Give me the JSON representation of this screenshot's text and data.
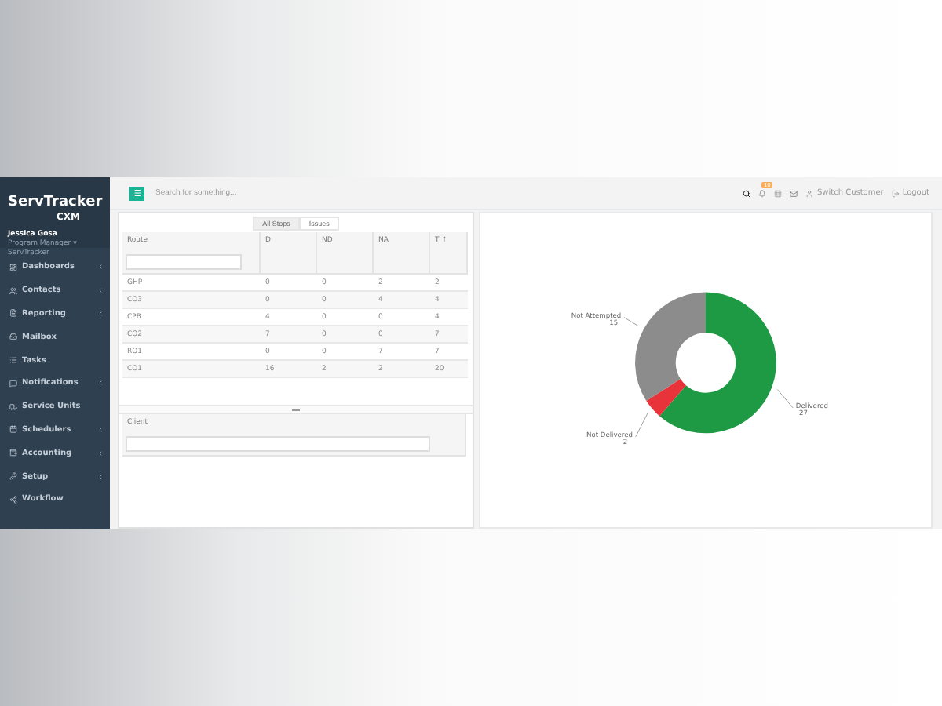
{
  "logo": {
    "name": "ServTracker",
    "product": "CXM"
  },
  "user": {
    "name": "Jessica Gosa",
    "role": "Program Manager ▾",
    "company": "ServTracker"
  },
  "sidebar": {
    "items": [
      {
        "label": "Dashboards",
        "expandable": true
      },
      {
        "label": "Contacts",
        "expandable": true
      },
      {
        "label": "Reporting",
        "expandable": true
      },
      {
        "label": "Mailbox",
        "expandable": false
      },
      {
        "label": "Tasks",
        "expandable": false
      },
      {
        "label": "Notifications",
        "expandable": true
      },
      {
        "label": "Service Units",
        "expandable": false
      },
      {
        "label": "Schedulers",
        "expandable": true
      },
      {
        "label": "Accounting",
        "expandable": true
      },
      {
        "label": "Setup",
        "expandable": true
      },
      {
        "label": "Workflow",
        "expandable": false
      }
    ]
  },
  "topbar": {
    "search": {
      "placeholder": "Search for something..."
    },
    "badge": "10",
    "switch_customer": "Switch Customer",
    "logout": "Logout"
  },
  "tabs": [
    {
      "label": "All Stops",
      "selected": true
    },
    {
      "label": "Issues",
      "selected": false
    }
  ],
  "table": {
    "columns": [
      "Route",
      "D",
      "ND",
      "NA",
      "T ↑"
    ],
    "rows": [
      [
        "GHP",
        "0",
        "0",
        "2",
        "2"
      ],
      [
        "CO3",
        "0",
        "0",
        "4",
        "4"
      ],
      [
        "CPB",
        "4",
        "0",
        "0",
        "4"
      ],
      [
        "CO2",
        "7",
        "0",
        "0",
        "7"
      ],
      [
        "RO1",
        "0",
        "0",
        "7",
        "7"
      ],
      [
        "CO1",
        "16",
        "2",
        "2",
        "20"
      ]
    ]
  },
  "client_table": {
    "columns": [
      "Client"
    ]
  },
  "chart_data": {
    "type": "donut",
    "categories": [
      "Delivered",
      "Not Delivered",
      "Not Attempted"
    ],
    "values": [
      27,
      2,
      15
    ],
    "colors": [
      "#1f9a44",
      "#e8333a",
      "#8c8c8c"
    ],
    "value_labels": [
      "27",
      "2",
      "15"
    ]
  }
}
